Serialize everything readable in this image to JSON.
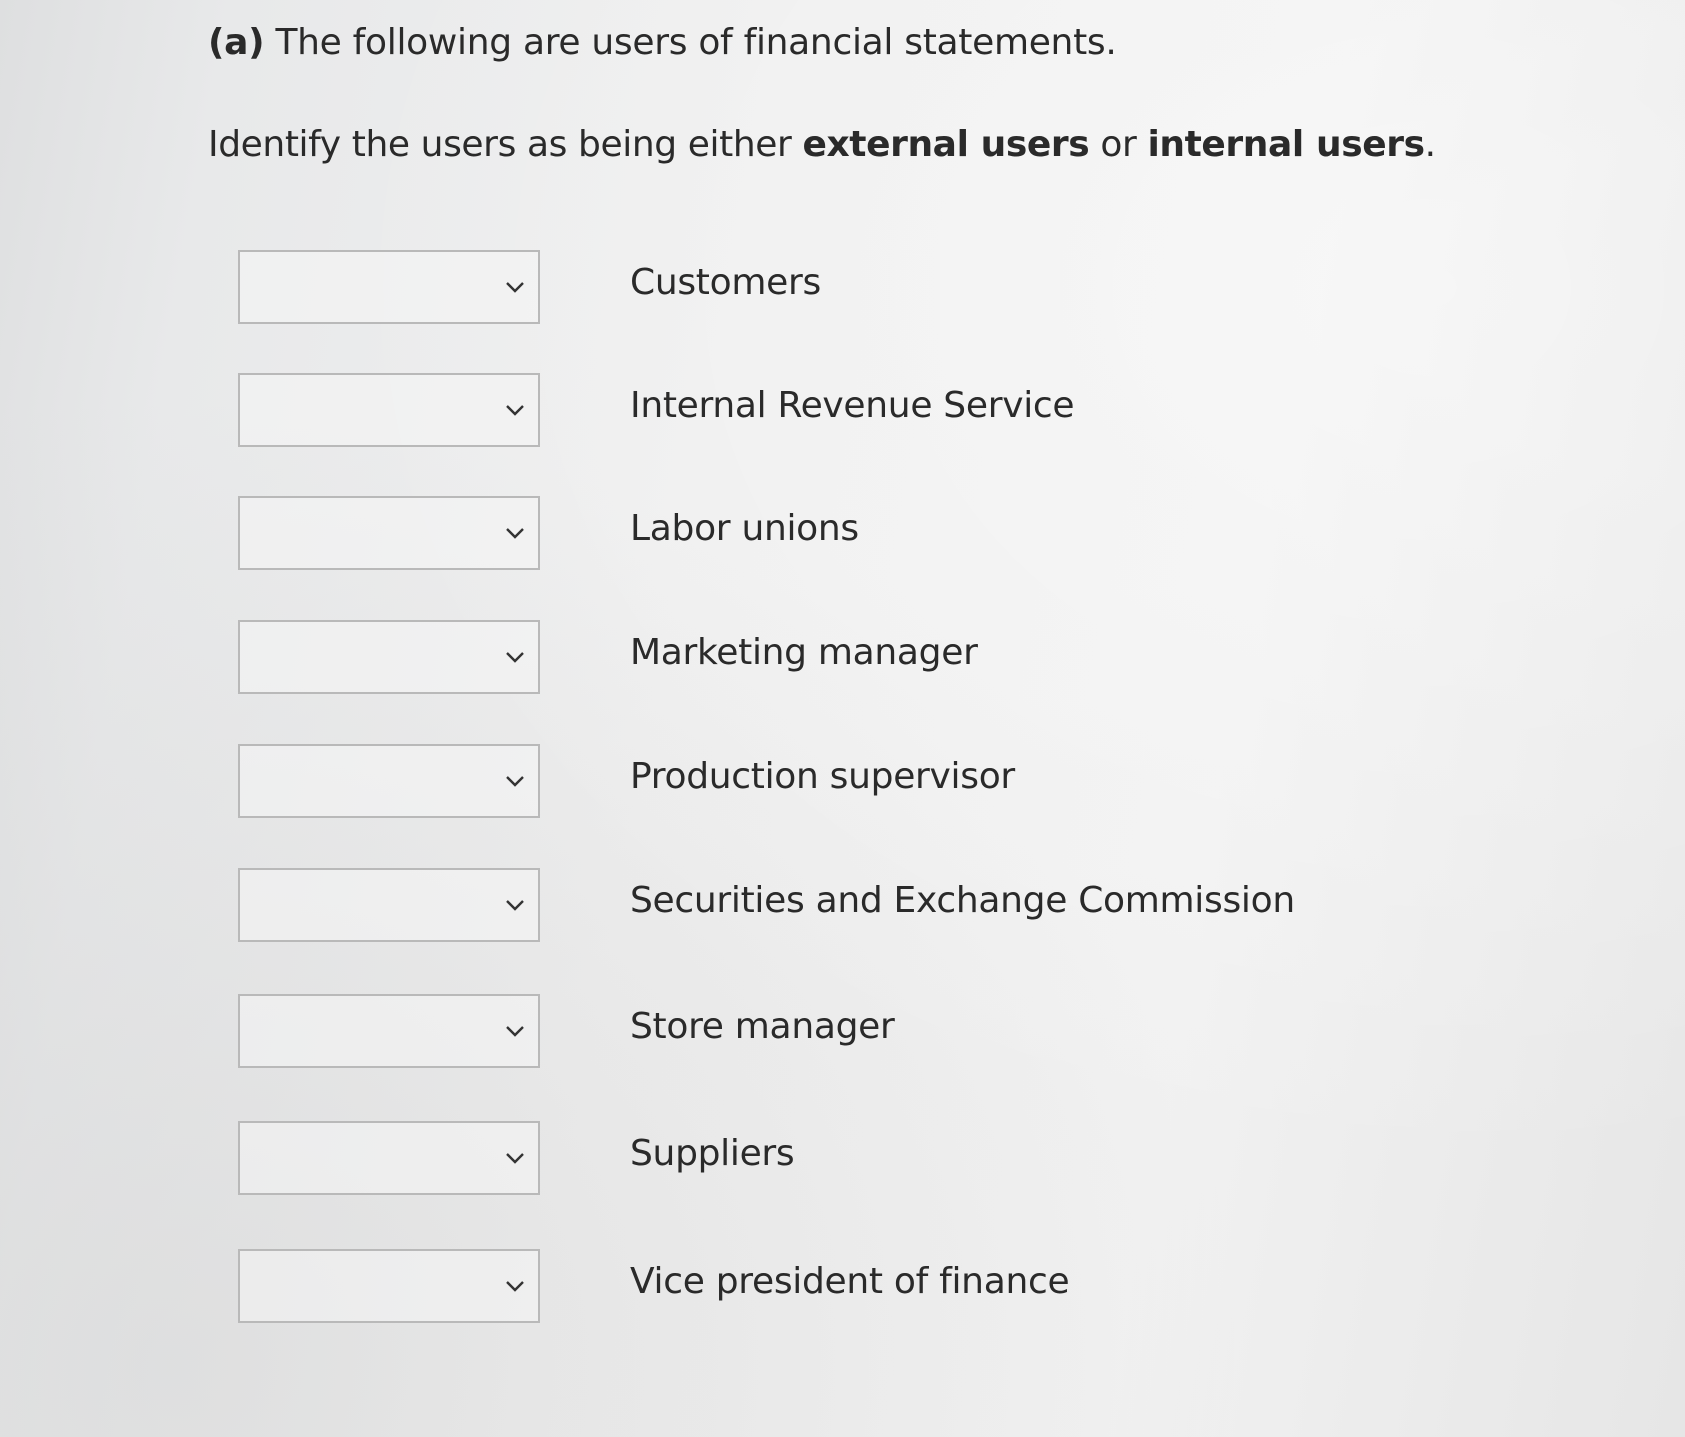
{
  "question": {
    "part": "(a)",
    "text": "The following are users of financial statements."
  },
  "instruction": {
    "prefix": "Identify the users as being either ",
    "external": "external users",
    "middle": " or ",
    "internal": "internal users",
    "suffix": "."
  },
  "dropdown_icon": "chevron-down-icon",
  "rows": [
    {
      "label": "Customers",
      "selected": ""
    },
    {
      "label": "Internal Revenue Service",
      "selected": ""
    },
    {
      "label": "Labor unions",
      "selected": ""
    },
    {
      "label": "Marketing manager",
      "selected": ""
    },
    {
      "label": "Production supervisor",
      "selected": ""
    },
    {
      "label": "Securities and Exchange Commission",
      "selected": ""
    },
    {
      "label": "Store manager",
      "selected": ""
    },
    {
      "label": "Suppliers",
      "selected": ""
    },
    {
      "label": "Vice president of finance",
      "selected": ""
    }
  ]
}
